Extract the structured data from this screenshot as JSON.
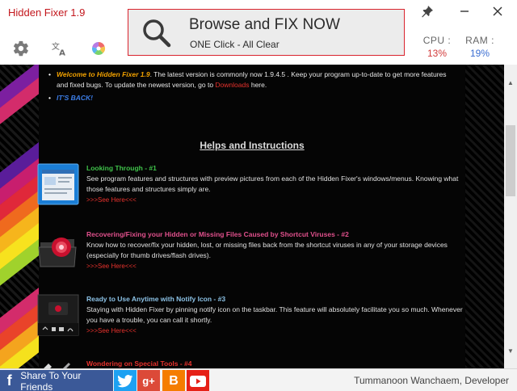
{
  "app": {
    "title": "Hidden Fixer 1.9"
  },
  "fix_button": {
    "main": "Browse and FIX NOW",
    "sub": "ONE Click - All Clear"
  },
  "stats": {
    "cpu": {
      "label": "CPU :",
      "value": "13%",
      "color": "#d23a3a"
    },
    "ram": {
      "label": "RAM :",
      "value": "19%",
      "color": "#3b6ed2"
    }
  },
  "icons": {
    "settings": "gear-icon",
    "language": "translate-icon",
    "theme": "color-wheel-icon",
    "pin": "pin-icon",
    "minimize": "minimize-icon",
    "close": "close-icon"
  },
  "notice": {
    "welcome": "Welcome to Hidden Fixer 1.9",
    "line1": ". The latest version is commonly now 1.9.4.5 . Keep your program up-to-date to get more features and fixed bugs. To update the newest version, go to ",
    "downloads": "Downloads",
    "after_downloads": " here.",
    "its_back": "IT'S BACK!"
  },
  "helps": {
    "heading": "Helps and Instructions",
    "items": [
      {
        "title": "Looking Through - #1",
        "title_color": "#3fc24a",
        "desc": "See program features and structures with preview pictures from each of the Hidden Fixer's windows/menus. Knowing what those features and structures simply are.",
        "link": ">>>See Here<<<"
      },
      {
        "title": "Recovering/Fixing your Hidden or Missing Files Caused by Shortcut Viruses - #2",
        "title_color": "#e0508c",
        "desc": "Know how to recover/fix your hidden, lost, or missing files back from the shortcut viruses in any of your storage devices (especially for thumb drives/flash drives).",
        "link": ">>>See Here<<<"
      },
      {
        "title": "Ready to Use Anytime with Notify Icon - #3",
        "title_color": "#8cc2e6",
        "desc": "Staying with Hidden Fixer by pinning notify icon on the taskbar. This feature will absolutely facilitate you so much. Whenever you have a trouble, you can call it shortly.",
        "link": ">>>See Here<<<"
      },
      {
        "title": "Wondering on Special Tools - #4",
        "title_color": "#e8322d",
        "desc": "",
        "link": ""
      }
    ]
  },
  "footer": {
    "share_label": "Share To Your Friends",
    "developer": "Tummanoon Wanchaem, Developer"
  },
  "colors": {
    "accent": "#c3161c",
    "facebook": "#3b5998",
    "twitter": "#1da1f2",
    "gplus": "#dc4a38",
    "blogger": "#f57d00",
    "youtube": "#e62117"
  }
}
